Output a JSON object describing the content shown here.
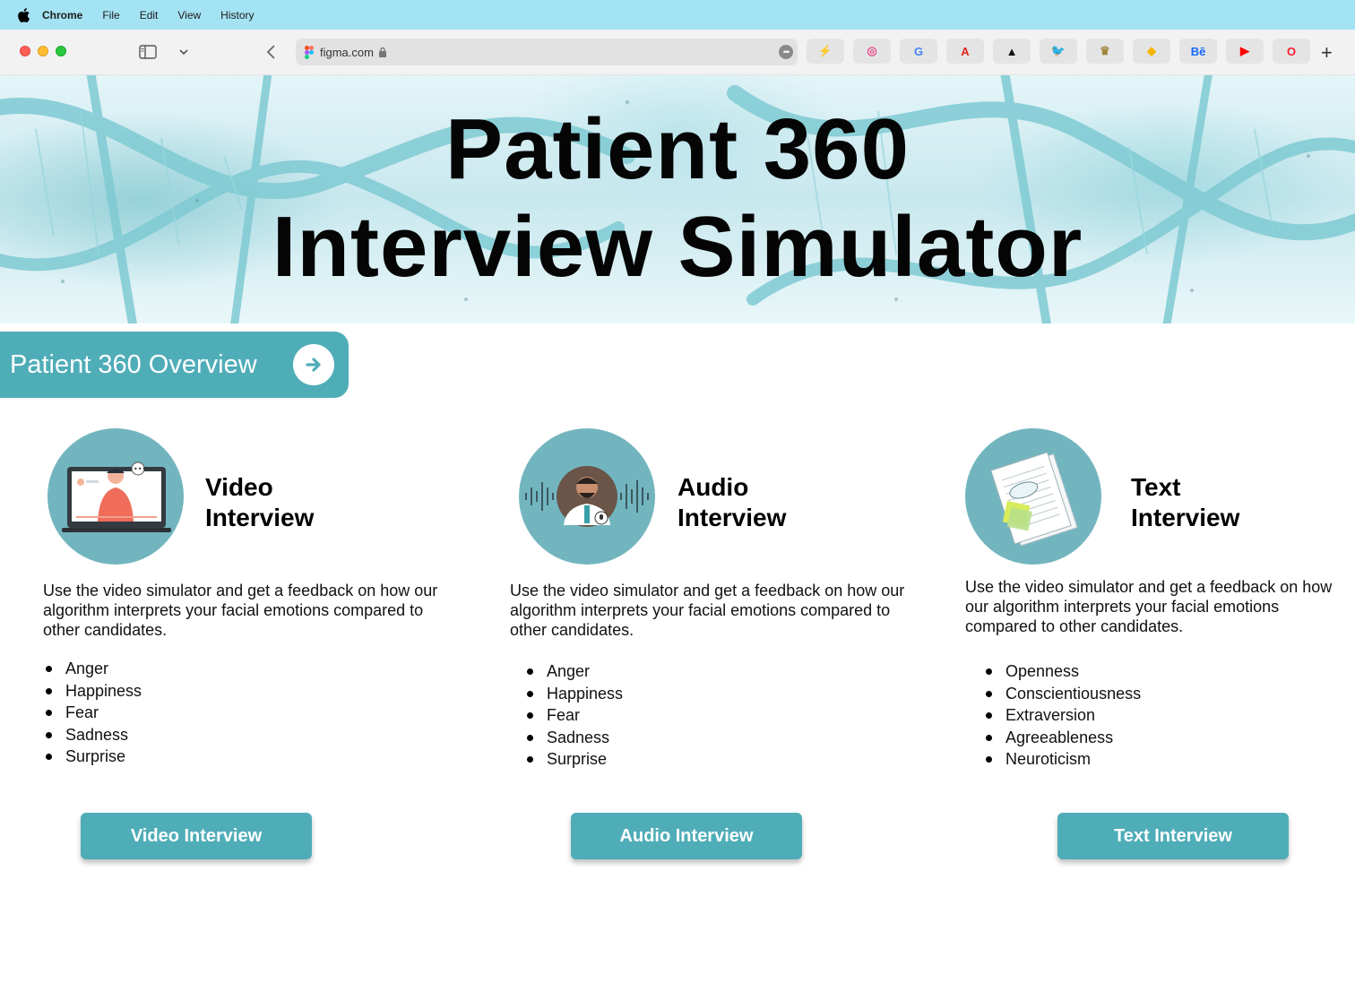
{
  "menubar": {
    "app_name": "Chrome",
    "items": [
      "File",
      "Edit",
      "View",
      "History"
    ]
  },
  "browser": {
    "url": "figma.com",
    "bookmarks": [
      {
        "name": "lightning-icon",
        "glyph": "⚡",
        "color": "#1a73e8"
      },
      {
        "name": "dribbble-icon",
        "glyph": "◎",
        "color": "#ea4c89"
      },
      {
        "name": "google-icon",
        "glyph": "G",
        "color": "#4285f4"
      },
      {
        "name": "adobe-icon",
        "glyph": "A",
        "color": "#e1251b"
      },
      {
        "name": "adidas-icon",
        "glyph": "▲",
        "color": "#111111"
      },
      {
        "name": "twitter-icon",
        "glyph": "🐦",
        "color": "#1da1f2"
      },
      {
        "name": "rolex-icon",
        "glyph": "♛",
        "color": "#a0863a"
      },
      {
        "name": "sketch-icon",
        "glyph": "◆",
        "color": "#f7b500"
      },
      {
        "name": "behance-icon",
        "glyph": "Bē",
        "color": "#1769ff"
      },
      {
        "name": "youtube-icon",
        "glyph": "▶",
        "color": "#ff0000"
      },
      {
        "name": "opera-icon",
        "glyph": "O",
        "color": "#ff1b2d"
      }
    ]
  },
  "hero": {
    "title_line1": "Patient 360",
    "title_line2": "Interview Simulator"
  },
  "overview_button": {
    "label": "Patient 360 Overview"
  },
  "colors": {
    "accent": "#4fadb8",
    "circle": "#72b5bf"
  },
  "cards": [
    {
      "title_line1": "Video",
      "title_line2": "Interview",
      "description": "Use the video simulator and get a feedback on how our algorithm interprets your facial emotions compared to other candidates.",
      "items": [
        "Anger",
        "Happiness",
        "Fear",
        "Sadness",
        "Surprise"
      ],
      "button": "Video Interview"
    },
    {
      "title_line1": "Audio",
      "title_line2": "Interview",
      "description": "Use the video simulator and get a feedback on how our algorithm interprets your facial emotions compared to other candidates.",
      "items": [
        "Anger",
        "Happiness",
        "Fear",
        "Sadness",
        "Surprise"
      ],
      "button": "Audio Interview"
    },
    {
      "title_line1": "Text",
      "title_line2": "Interview",
      "description": "Use the video simulator and get a feedback on how our algorithm interprets your facial emotions compared to other candidates.",
      "items": [
        "Openness",
        "Conscientiousness",
        "Extraversion",
        "Agreeableness",
        "Neuroticism"
      ],
      "button": "Text Interview"
    }
  ]
}
